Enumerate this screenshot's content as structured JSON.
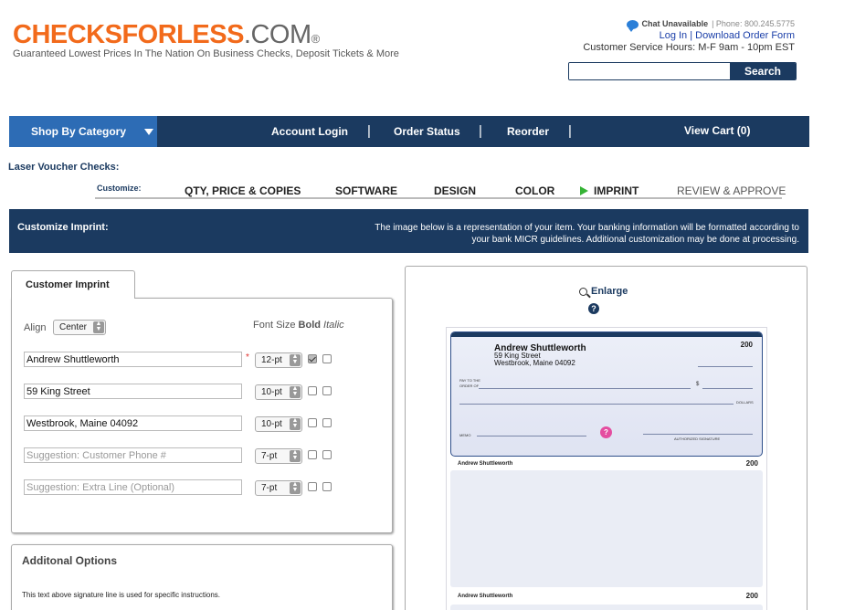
{
  "header": {
    "logo_main": "CHECKSFORLESS",
    "logo_suffix": ".COM",
    "logo_reg": "®",
    "tagline": "Guaranteed Lowest Prices In The Nation On Business Checks, Deposit Tickets & More",
    "chat_status": "Chat Unavailable",
    "phone": "| Phone: 800.245.5775",
    "login_link": "Log In",
    "link_separator": " | ",
    "download_link": "Download Order Form",
    "hours": "Customer Service Hours: M-F 9am - 10pm EST",
    "search_value": "",
    "search_button": "Search"
  },
  "nav": {
    "shop": "Shop By Category",
    "account_login": "Account Login",
    "order_status": "Order Status",
    "reorder": "Reorder",
    "separator": "|",
    "view_cart": "View Cart (0)"
  },
  "product": {
    "title": "Laser Voucher Checks:"
  },
  "steps": {
    "customize_label": "Customize:",
    "qty": "QTY, PRICE & COPIES",
    "software": "SOFTWARE",
    "design": "DESIGN",
    "color": "COLOR",
    "imprint": "IMPRINT",
    "review": "REVIEW & APPROVE"
  },
  "banner": {
    "title": "Customize Imprint:",
    "text": "The image below is a representation of your item. Your banking information will be formatted according to your bank MICR guidelines. Additional customization may be done at processing."
  },
  "imprint": {
    "tab": "Customer Imprint",
    "align_label": "Align",
    "align_value": "Center",
    "font_size_label": "Font Size",
    "bold_label": "Bold",
    "italic_label": "Italic",
    "required_mark": "*",
    "lines": [
      {
        "value": "Andrew Shuttleworth",
        "placeholder": "",
        "size": "12-pt",
        "bold": true
      },
      {
        "value": "59 King Street",
        "placeholder": "",
        "size": "10-pt",
        "bold": false
      },
      {
        "value": "Westbrook, Maine 04092",
        "placeholder": "",
        "size": "10-pt",
        "bold": false
      },
      {
        "value": "",
        "placeholder": "Suggestion: Customer Phone #",
        "size": "7-pt",
        "bold": false
      },
      {
        "value": "",
        "placeholder": "Suggestion: Extra Line (Optional)",
        "size": "7-pt",
        "bold": false
      }
    ]
  },
  "options": {
    "title": "Additonal Options",
    "text": "This text above signature line is used for specific instructions."
  },
  "preview": {
    "enlarge": "Enlarge",
    "help": "?",
    "check_name": "Andrew Shuttleworth",
    "check_street": "59 King Street",
    "check_city": "Westbrook, Maine 04092",
    "check_number": "200",
    "pay_label": "PAY TO THE",
    "order_label": "ORDER OF",
    "dollar_sign": "$",
    "dollars_label": "DOLLARS",
    "memo_label": "MEMO",
    "signature_label": "AUTHORIZED SIGNATURE",
    "stub_name": "Andrew Shuttleworth",
    "stub_number": "200"
  },
  "colors": {
    "brand_orange": "#f26a1b",
    "navy": "#1b3a60",
    "shop_blue": "#2d6cb5",
    "active_green": "#35b335"
  }
}
